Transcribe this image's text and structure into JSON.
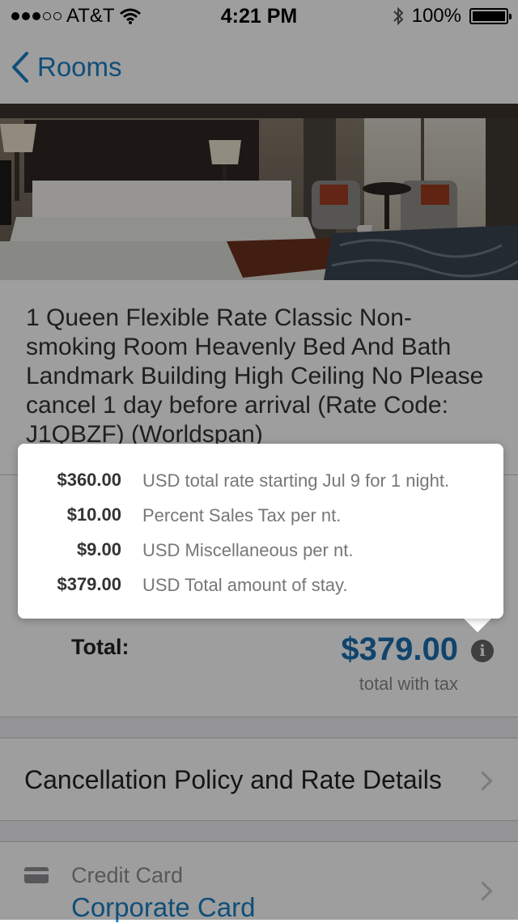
{
  "status_bar": {
    "carrier": "AT&T",
    "time": "4:21 PM",
    "battery": "100%",
    "signal_bars_filled": 3,
    "signal_bars_total": 5
  },
  "nav": {
    "back_label": "Rooms"
  },
  "hero": {
    "alt": "Hotel room photo"
  },
  "room": {
    "description": "1 Queen Flexible Rate Classic Non-smoking Room Heavenly Bed And Bath Landmark Building High Ceiling No Please cancel 1 day before arrival (Rate Code: J1QBZF) (Worldspan)"
  },
  "total": {
    "label": "Total:",
    "amount": "$379.00",
    "subtitle": "total with tax"
  },
  "cancellation": {
    "label": "Cancellation Policy and Rate Details"
  },
  "payment": {
    "label": "Credit Card",
    "value": "Corporate Card"
  },
  "breakdown": [
    {
      "amount": "$360.00",
      "description": "USD total rate starting Jul 9 for 1 night."
    },
    {
      "amount": "$10.00",
      "description": "Percent Sales Tax per nt."
    },
    {
      "amount": "$9.00",
      "description": "USD Miscellaneous per nt."
    },
    {
      "amount": "$379.00",
      "description": "USD Total amount of stay."
    }
  ],
  "colors": {
    "accent": "#1b7fc4",
    "total_amount": "#1b6fb0",
    "overlay": "rgba(0,0,0,0.38)"
  },
  "icons": [
    "back-chevron-icon",
    "wifi-icon",
    "bluetooth-icon",
    "battery-icon",
    "info-icon",
    "chevron-right-icon",
    "credit-card-icon"
  ]
}
